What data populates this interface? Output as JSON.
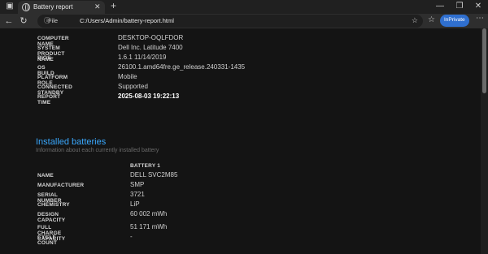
{
  "browser": {
    "tab_title": "Battery report",
    "tab_close": "✕",
    "new_tab": "+",
    "file_label": "File",
    "url": "C:/Users/Admin/battery-report.html",
    "inprivate_label": "InPrivate",
    "icons": {
      "tab_icon": "globe-icon",
      "back": "←",
      "refresh": "↻",
      "star": "☆",
      "favorites": "☆",
      "collections": "⧉",
      "minimize": "—",
      "maximize": "❐",
      "close": "✕",
      "more": "⋯"
    }
  },
  "system_info": [
    {
      "label": "COMPUTER NAME",
      "value": "DESKTOP-OQLFDOR"
    },
    {
      "label": "SYSTEM PRODUCT NAME",
      "value": "Dell Inc. Latitude 7400"
    },
    {
      "label": "BIOS",
      "value": "1.6.1 11/14/2019"
    },
    {
      "label": "OS BUILD",
      "value": "26100.1.amd64fre.ge_release.240331-1435"
    },
    {
      "label": "PLATFORM ROLE",
      "value": "Mobile"
    },
    {
      "label": "CONNECTED STANDBY",
      "value": "Supported"
    },
    {
      "label": "REPORT TIME",
      "value": "2025-08-03  19:22:13"
    }
  ],
  "installed_batteries": {
    "title": "Installed batteries",
    "subtitle": "Information about each currently installed battery",
    "column_header": "BATTERY 1",
    "rows": [
      {
        "label": "NAME",
        "value": "DELL SVC2M85"
      },
      {
        "label": "MANUFACTURER",
        "value": "SMP"
      },
      {
        "label": "SERIAL NUMBER",
        "value": "3721"
      },
      {
        "label": "CHEMISTRY",
        "value": "LiP"
      },
      {
        "label": "DESIGN CAPACITY",
        "value": "60 002 mWh"
      },
      {
        "label": "FULL CHARGE CAPACITY",
        "value": "51 171 mWh"
      },
      {
        "label": "CYCLE COUNT",
        "value": "-"
      }
    ]
  },
  "colors": {
    "accent_heading": "#3aa9ff",
    "inprivate_badge": "#2f6fcf",
    "page_background": "#141414"
  }
}
